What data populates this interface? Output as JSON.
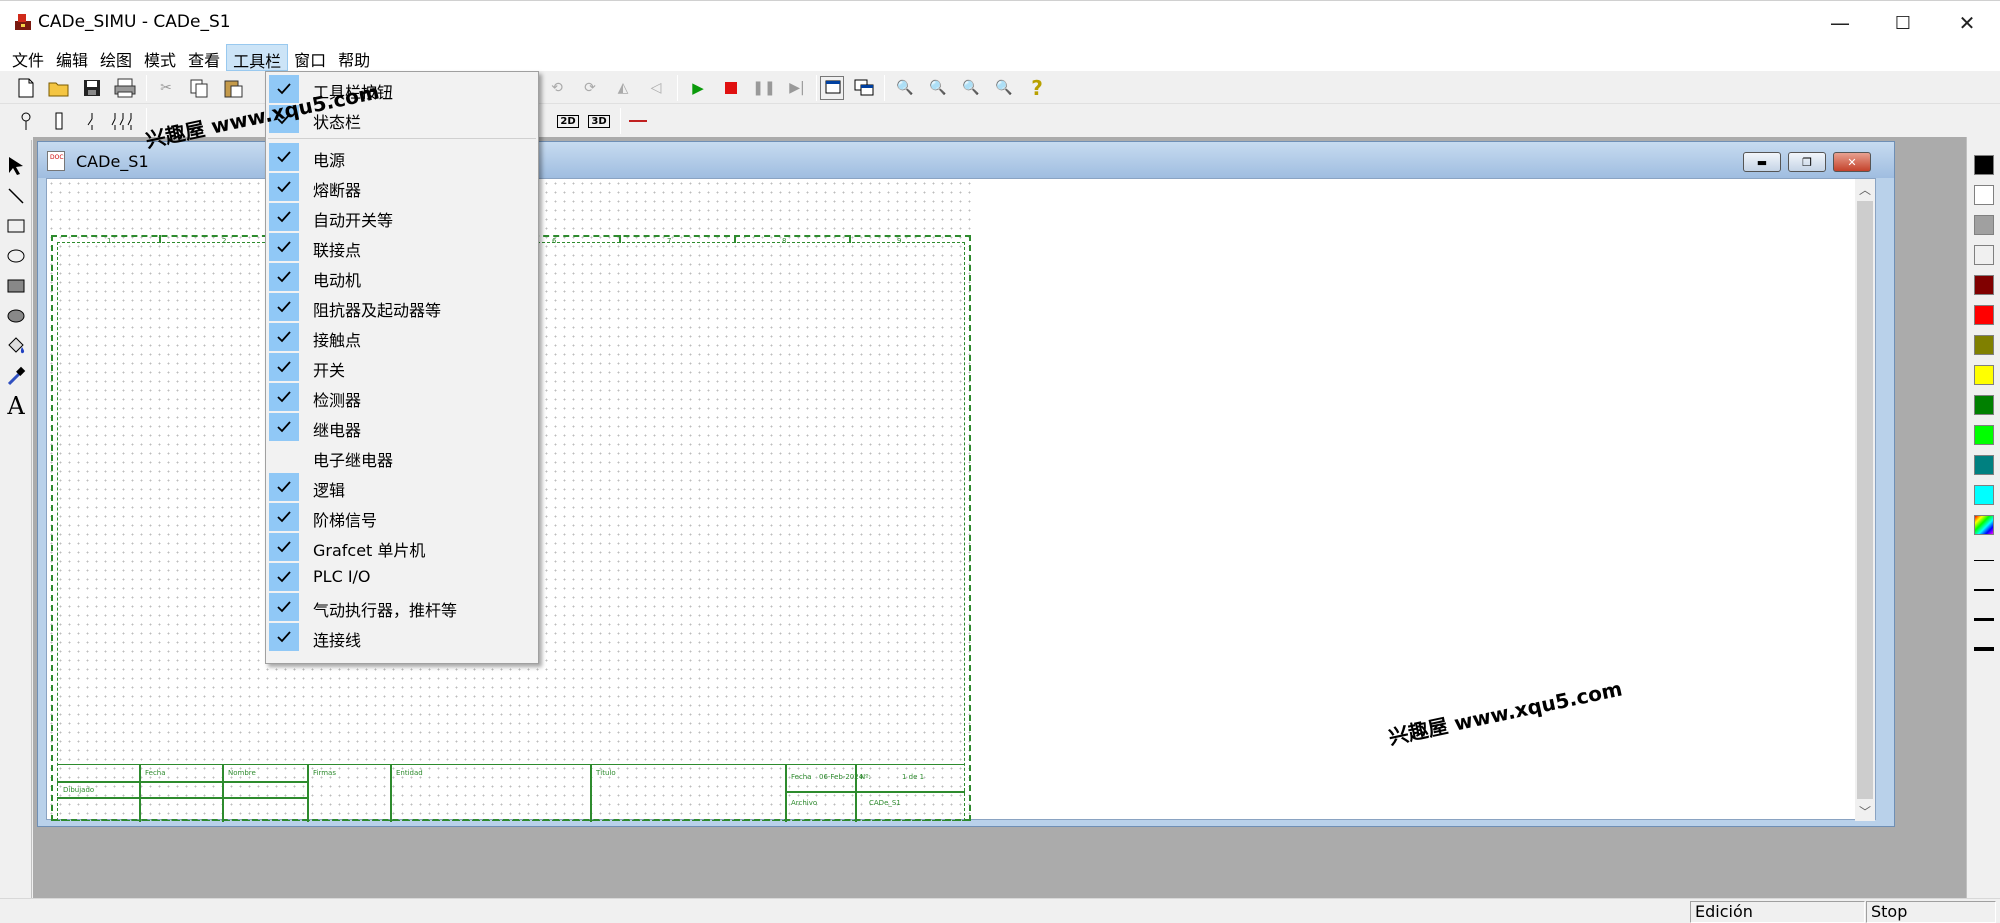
{
  "window": {
    "title": "CADe_SIMU - CADe_S1",
    "minimize_glyph": "—",
    "maximize_glyph": "☐",
    "close_glyph": "✕"
  },
  "menubar": [
    {
      "label": "文件"
    },
    {
      "label": "编辑"
    },
    {
      "label": "绘图"
    },
    {
      "label": "模式"
    },
    {
      "label": "查看"
    },
    {
      "label": "工具栏",
      "active": true
    },
    {
      "label": "窗口"
    },
    {
      "label": "帮助"
    }
  ],
  "toolbar_menu": {
    "items": [
      {
        "label": "工具栏按钮",
        "checked": true
      },
      {
        "label": "状态栏",
        "checked": true
      },
      {
        "label": "电源",
        "checked": true
      },
      {
        "label": "熔断器",
        "checked": true
      },
      {
        "label": "自动开关等",
        "checked": true
      },
      {
        "label": "联接点",
        "checked": true
      },
      {
        "label": "电动机",
        "checked": true
      },
      {
        "label": "阻抗器及起动器等",
        "checked": true
      },
      {
        "label": "接触点",
        "checked": true
      },
      {
        "label": "开关",
        "checked": true
      },
      {
        "label": "检测器",
        "checked": true
      },
      {
        "label": "继电器",
        "checked": true
      },
      {
        "label": "电子继电器",
        "checked": false
      },
      {
        "label": "逻辑",
        "checked": true
      },
      {
        "label": "阶梯信号",
        "checked": true
      },
      {
        "label": "Grafcet 单片机",
        "checked": true
      },
      {
        "label": "PLC I/O",
        "checked": true
      },
      {
        "label": "气动执行器，推杆等",
        "checked": true
      },
      {
        "label": "连接线",
        "checked": true
      }
    ]
  },
  "toolbar2_labels": {
    "btn_2d": "2D",
    "btn_3d": "3D"
  },
  "child_window": {
    "title": "CADe_S1",
    "icon_text": "DOC",
    "min_glyph": "▬",
    "restore_glyph": "❐",
    "close_glyph": "✕",
    "cartouche": {
      "fecha": "Fecha",
      "nombre": "Nombre",
      "firmas": "Firmas",
      "entidad": "Entidad",
      "titulo": "Título",
      "dibujado": "Dibujado",
      "fecha2": "Fecha",
      "fecha_val": "06-Feb-2024",
      "nro": "Nº:",
      "nro_val": "1 de 1",
      "archivo": "Archivo",
      "archivo_val": "CADe_S1"
    },
    "frame_numbers": [
      "1",
      "2",
      "3",
      "4",
      "5",
      "6",
      "7",
      "8",
      "9",
      "10"
    ]
  },
  "status": {
    "panel1": "Edición",
    "panel2": "Stop"
  },
  "watermark": {
    "text": "兴趣屋 www.xqu5.com"
  },
  "colors": {
    "palette": [
      "#000000",
      "#ffffff",
      "#a0a0a0",
      "#f0f0f0",
      "#800000",
      "#ff0000",
      "#808000",
      "#ffff00",
      "#008000",
      "#00ff00",
      "#008080",
      "#00ffff"
    ],
    "accent_check": "#90c8f6",
    "frame_green": "#2e8b2e"
  }
}
